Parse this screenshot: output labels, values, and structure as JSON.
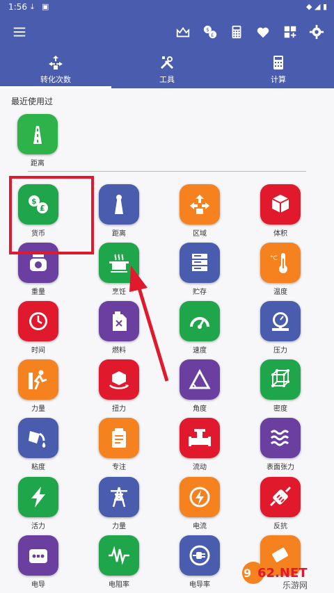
{
  "status_bar": {
    "time": "1:56"
  },
  "toolbar": {
    "icons": [
      "menu-icon",
      "crown-icon",
      "currency-exchange-icon",
      "calculator-icon",
      "heart-icon",
      "add-widget-icon",
      "gear-icon"
    ]
  },
  "tabs": [
    {
      "label": "转化次数",
      "icon": "convert-icon",
      "selected": true
    },
    {
      "label": "工具",
      "icon": "tools-icon",
      "selected": false
    },
    {
      "label": "计算",
      "icon": "calculator-icon",
      "selected": false
    }
  ],
  "recent": {
    "title": "最近使用过",
    "items": [
      {
        "label": "距离",
        "icon": "road-icon",
        "color": "#2db34a"
      }
    ]
  },
  "grid": [
    {
      "label": "货币",
      "icon": "currency-icon",
      "color": "#1fa64a"
    },
    {
      "label": "距离",
      "icon": "road-icon",
      "color": "#4a5cad"
    },
    {
      "label": "区域",
      "icon": "area-icon",
      "color": "#f5821f"
    },
    {
      "label": "体积",
      "icon": "cube-icon",
      "color": "#e0192d"
    },
    {
      "label": "重量",
      "icon": "scale-icon",
      "color": "#6b3fa0"
    },
    {
      "label": "烹饪",
      "icon": "cooking-pot-icon",
      "color": "#1fa64a"
    },
    {
      "label": "贮存",
      "icon": "storage-icon",
      "color": "#4a5cad"
    },
    {
      "label": "温度",
      "icon": "thermometer-icon",
      "color": "#f5821f"
    },
    {
      "label": "时间",
      "icon": "clock-icon",
      "color": "#e0192d"
    },
    {
      "label": "燃料",
      "icon": "fuel-can-icon",
      "color": "#6b3fa0"
    },
    {
      "label": "速度",
      "icon": "speedometer-icon",
      "color": "#1fa64a"
    },
    {
      "label": "压力",
      "icon": "pressure-gauge-icon",
      "color": "#4a5cad"
    },
    {
      "label": "力量",
      "icon": "force-icon",
      "color": "#f5821f"
    },
    {
      "label": "扭力",
      "icon": "torque-icon",
      "color": "#e0192d"
    },
    {
      "label": "角度",
      "icon": "angle-icon",
      "color": "#6b3fa0"
    },
    {
      "label": "密度",
      "icon": "density-icon",
      "color": "#1fa64a"
    },
    {
      "label": "粘度",
      "icon": "viscosity-icon",
      "color": "#4a5cad"
    },
    {
      "label": "专注",
      "icon": "concentration-icon",
      "color": "#f5821f"
    },
    {
      "label": "流动",
      "icon": "valve-icon",
      "color": "#e0192d"
    },
    {
      "label": "表面张力",
      "icon": "waves-icon",
      "color": "#6b3fa0"
    },
    {
      "label": "活力",
      "icon": "lightning-icon",
      "color": "#1fa64a"
    },
    {
      "label": "力量",
      "icon": "power-tower-icon",
      "color": "#4a5cad"
    },
    {
      "label": "电流",
      "icon": "current-icon",
      "color": "#f5821f"
    },
    {
      "label": "反抗",
      "icon": "resistor-icon",
      "color": "#e0192d"
    },
    {
      "label": "电导",
      "icon": "socket-icon",
      "color": "#6b3fa0"
    },
    {
      "label": "电阻率",
      "icon": "waveform-icon",
      "color": "#1fa64a"
    },
    {
      "label": "电导率",
      "icon": "plug-icon",
      "color": "#4a5cad"
    },
    {
      "label": "",
      "icon": "eraser-icon",
      "color": "#f5821f"
    }
  ],
  "watermark": {
    "brand": "962.NET",
    "sub": "乐游网"
  }
}
